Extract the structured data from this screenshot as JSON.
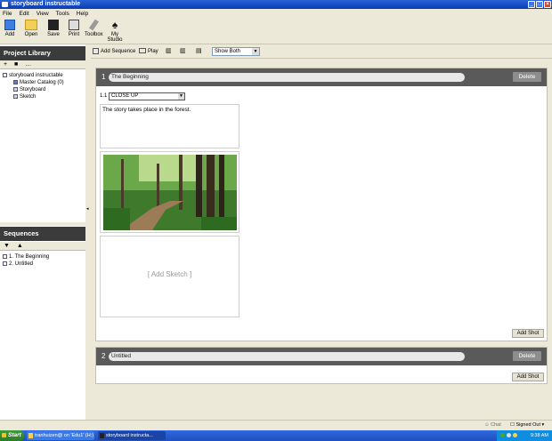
{
  "window": {
    "title": "storyboard instructable"
  },
  "menu": [
    "File",
    "Edit",
    "View",
    "Tools",
    "Help"
  ],
  "toolbar": {
    "add": "Add",
    "open": "Open",
    "save": "Save",
    "print": "Print",
    "toolbox": "Toolbox",
    "my_studio": "My Studio"
  },
  "project_library": {
    "title": "Project Library",
    "tree": {
      "root": "storyboard instructable",
      "master_catalog": "Master Catalog (0)",
      "storyboard": "Storyboard",
      "sketch": "Sketch"
    }
  },
  "sequences_panel": {
    "title": "Sequences",
    "items": [
      "1. The Beginning",
      "2. Untitled"
    ]
  },
  "subtoolbar": {
    "add_sequence": "Add Sequence",
    "play": "Play",
    "view_select": "Show Both"
  },
  "sequences": [
    {
      "number": "1",
      "title": "The Beginning",
      "delete_label": "Delete",
      "add_shot_label": "Add Shot",
      "shot": {
        "number": "1.1",
        "type": "CLOSE UP",
        "description": "The story takes place in the forest.",
        "add_sketch": "[ Add Sketch ]"
      }
    },
    {
      "number": "2",
      "title": "Untitled",
      "delete_label": "Delete",
      "add_shot_label": "Add Shot"
    }
  ],
  "status": {
    "chat": "Chat",
    "signed_out": "Signed Out"
  },
  "taskbar": {
    "start": "Start",
    "task1": "tranhuizen@ on 'Edu1' (H:)",
    "task2": "storyboard instructa...",
    "time": "9:38 AM"
  }
}
